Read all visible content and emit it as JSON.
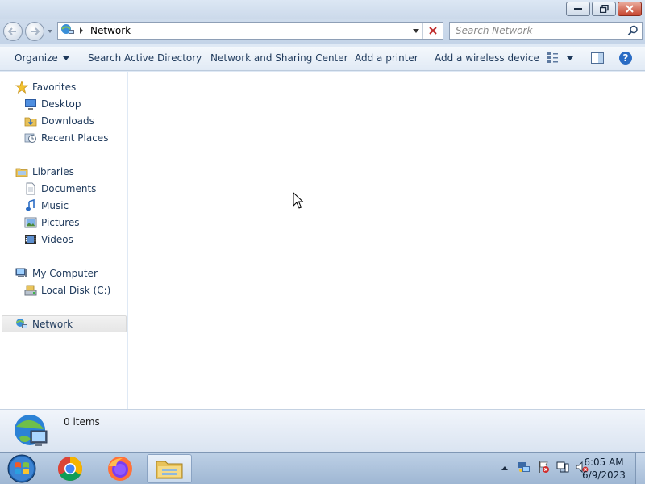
{
  "window": {
    "address": {
      "location": "Network"
    },
    "search": {
      "placeholder": "Search Network"
    }
  },
  "toolbar": {
    "organize": "Organize",
    "search_ad": "Search Active Directory",
    "network_sharing": "Network and Sharing Center",
    "add_printer": "Add a printer",
    "add_wireless": "Add a wireless device"
  },
  "navpane": {
    "favorites": {
      "label": "Favorites",
      "items": [
        {
          "label": "Desktop",
          "icon": "desktop-icon"
        },
        {
          "label": "Downloads",
          "icon": "downloads-folder-icon"
        },
        {
          "label": "Recent Places",
          "icon": "recent-places-icon"
        }
      ]
    },
    "libraries": {
      "label": "Libraries",
      "items": [
        {
          "label": "Documents",
          "icon": "documents-icon"
        },
        {
          "label": "Music",
          "icon": "music-icon"
        },
        {
          "label": "Pictures",
          "icon": "pictures-icon"
        },
        {
          "label": "Videos",
          "icon": "videos-icon"
        }
      ]
    },
    "computer": {
      "label": "My Computer",
      "items": [
        {
          "label": "Local Disk (C:)",
          "icon": "drive-icon"
        }
      ]
    },
    "network": {
      "label": "Network",
      "selected": true
    }
  },
  "details": {
    "count": "0 items"
  },
  "taskbar": {
    "apps": [
      "start-button",
      "chrome",
      "firefox",
      "windows-explorer"
    ],
    "active_app": "windows-explorer",
    "clock": {
      "time": "6:05 AM",
      "date": "6/9/2023"
    }
  },
  "colors": {
    "nav_text": "#1e395b",
    "content_bg": "#ffffff",
    "toolbar_bg": "#e6eef8",
    "taskbar_bg": "#a9bfd9"
  }
}
